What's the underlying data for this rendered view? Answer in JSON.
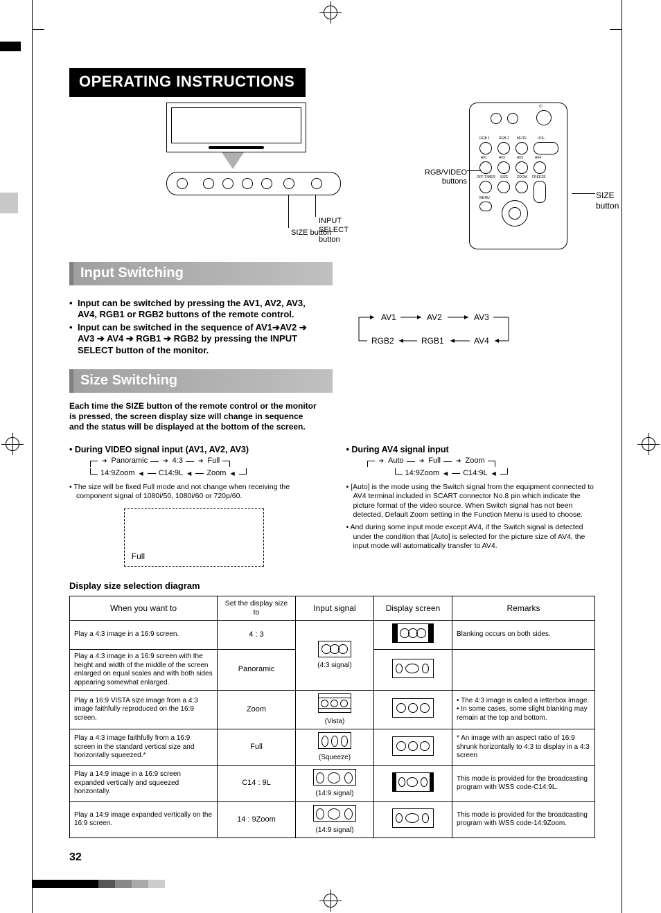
{
  "page_number": "32",
  "title_banner": "OPERATING INSTRUCTIONS",
  "figures": {
    "monitor": {
      "label_input_select": "INPUT SELECT button",
      "label_size": "SIZE button"
    },
    "remote": {
      "label_rgb_video_1": "RGB/VIDEO",
      "label_rgb_video_2": "buttons",
      "label_size": "SIZE button",
      "tiny_labels": {
        "rgb1": "RGB 1",
        "rgb2": "RGB 2",
        "mute": "MUTE",
        "vol": "VOL.",
        "av1": "AV1",
        "av2": "AV2",
        "av3": "AV3",
        "av4": "AV4",
        "off": "OFF TIMER",
        "size": "SIZE",
        "zoom": "ZOOM",
        "freeze": "FREEZE",
        "menu": "MENU"
      }
    }
  },
  "sections": {
    "input_switching": {
      "heading": "Input Switching",
      "bullets": [
        "Input can be switched by pressing the AV1, AV2, AV3, AV4, RGB1 or RGB2 buttons of the remote control.",
        "Input can be switched in the sequence of AV1➔AV2 ➔ AV3 ➔ AV4 ➔ RGB1 ➔ RGB2 by pressing the INPUT SELECT button of the monitor."
      ],
      "sequence_top": [
        "AV1",
        "AV2",
        "AV3"
      ],
      "sequence_bottom": [
        "RGB2",
        "RGB1",
        "AV4"
      ]
    },
    "size_switching": {
      "heading": "Size Switching",
      "intro": "Each time the SIZE button of the remote control or the monitor is pressed, the screen display size will change in sequence and the status will be displayed at the bottom of the screen.",
      "video_signal": {
        "title": "• During VIDEO signal input (AV1, AV2, AV3)",
        "seq_top": [
          "Panoramic",
          "4:3",
          "Full"
        ],
        "seq_bottom": [
          "14:9Zoom",
          "C14:9L",
          "Zoom"
        ],
        "note": "The size will be fixed Full mode and not change when receiving the component signal of 1080i/50, 1080i/60 or 720p/60.",
        "box_label": "Full"
      },
      "av4_signal": {
        "title": "• During AV4 signal input",
        "seq_top": [
          "Auto",
          "Full",
          "Zoom"
        ],
        "seq_bottom": [
          "14:9Zoom",
          "C14:9L"
        ],
        "note1": "[Auto] is the mode using the Switch signal from the equipment connected to AV4 terminal included in SCART connector No.8 pin which indicate the picture format of the video source. When Switch signal has not been detected, Default Zoom setting in the Function Menu is used to choose.",
        "note2": "And during some input mode except AV4, if the Switch signal is detected under the condition that [Auto] is selected for the picture size of AV4, the input mode will automatically transfer to AV4."
      }
    }
  },
  "table": {
    "title": "Display size selection diagram",
    "headers": {
      "when": "When you want to",
      "set": "Set the display size to",
      "input": "Input signal",
      "display": "Display screen",
      "remarks": "Remarks"
    },
    "rows": [
      {
        "when": "Play a 4:3 image in a 16:9 screen.",
        "set": "4 : 3",
        "remarks": "Blanking occurs on both sides."
      },
      {
        "when": "Play a 4:3 image in a 16:9 screen with the height and width of the middle of the screen enlarged on equal scales and with both sides appearing somewhat enlarged.",
        "set": "Panoramic",
        "remarks": ""
      },
      {
        "when": "Play a 16:9 VISTA size image from a 4:3 image faithfully reproduced on the 16:9 screen.",
        "set": "Zoom",
        "remarks": "• The 4:3 image is called a letterbox image.\n• In some cases, some slight blanking may remain at the top and bottom."
      },
      {
        "when": "Play a 4:3 image faithfully from a 16:9 screen in the standard vertical size and horizontally squeezed.*",
        "set": "Full",
        "remarks": "* An image with an aspect ratio of 16:9 shrunk horizontally to 4:3 to display in a 4:3 screen"
      },
      {
        "when": "Play a 14:9 image in a 16:9 screen expanded vertically and squeezed horizontally.",
        "set": "C14 : 9L",
        "remarks": "This mode is provided for the broadcasting program with WSS code-C14:9L."
      },
      {
        "when": "Play a 14:9 image expanded vertically on the 16:9 screen.",
        "set": "14 : 9Zoom",
        "remarks": "This mode is provided for the broadcasting program with WSS code-14:9Zoom."
      }
    ],
    "input_signal_labels": {
      "s43": "(4:3 signal)",
      "vista": "(Vista)",
      "squeeze": "(Squeeze)",
      "s149": "(14:9 signal)"
    }
  },
  "footer_colors": [
    "#000000",
    "#000000",
    "#000000",
    "#000000",
    "#555555",
    "#888888",
    "#aaaaaa",
    "#cccccc"
  ]
}
